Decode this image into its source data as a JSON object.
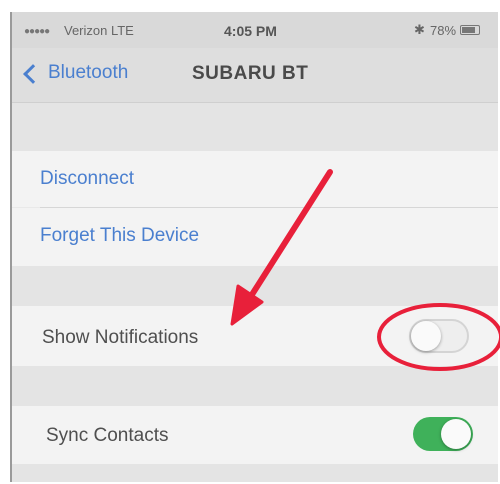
{
  "status_bar": {
    "signal": "●●●●●",
    "carrier": "Verizon  LTE",
    "time": "4:05 PM",
    "battery": "78%"
  },
  "nav": {
    "back_label": "Bluetooth",
    "title": "SUBARU BT"
  },
  "actions": {
    "disconnect": "Disconnect",
    "forget": "Forget This Device"
  },
  "settings": [
    {
      "label": "Show Notifications",
      "enabled": false
    },
    {
      "label": "Sync Contacts",
      "enabled": true
    }
  ],
  "colors": {
    "link": "#4a7fcf",
    "toggle_on": "#3fb15a",
    "annotation": "#e8203a"
  }
}
